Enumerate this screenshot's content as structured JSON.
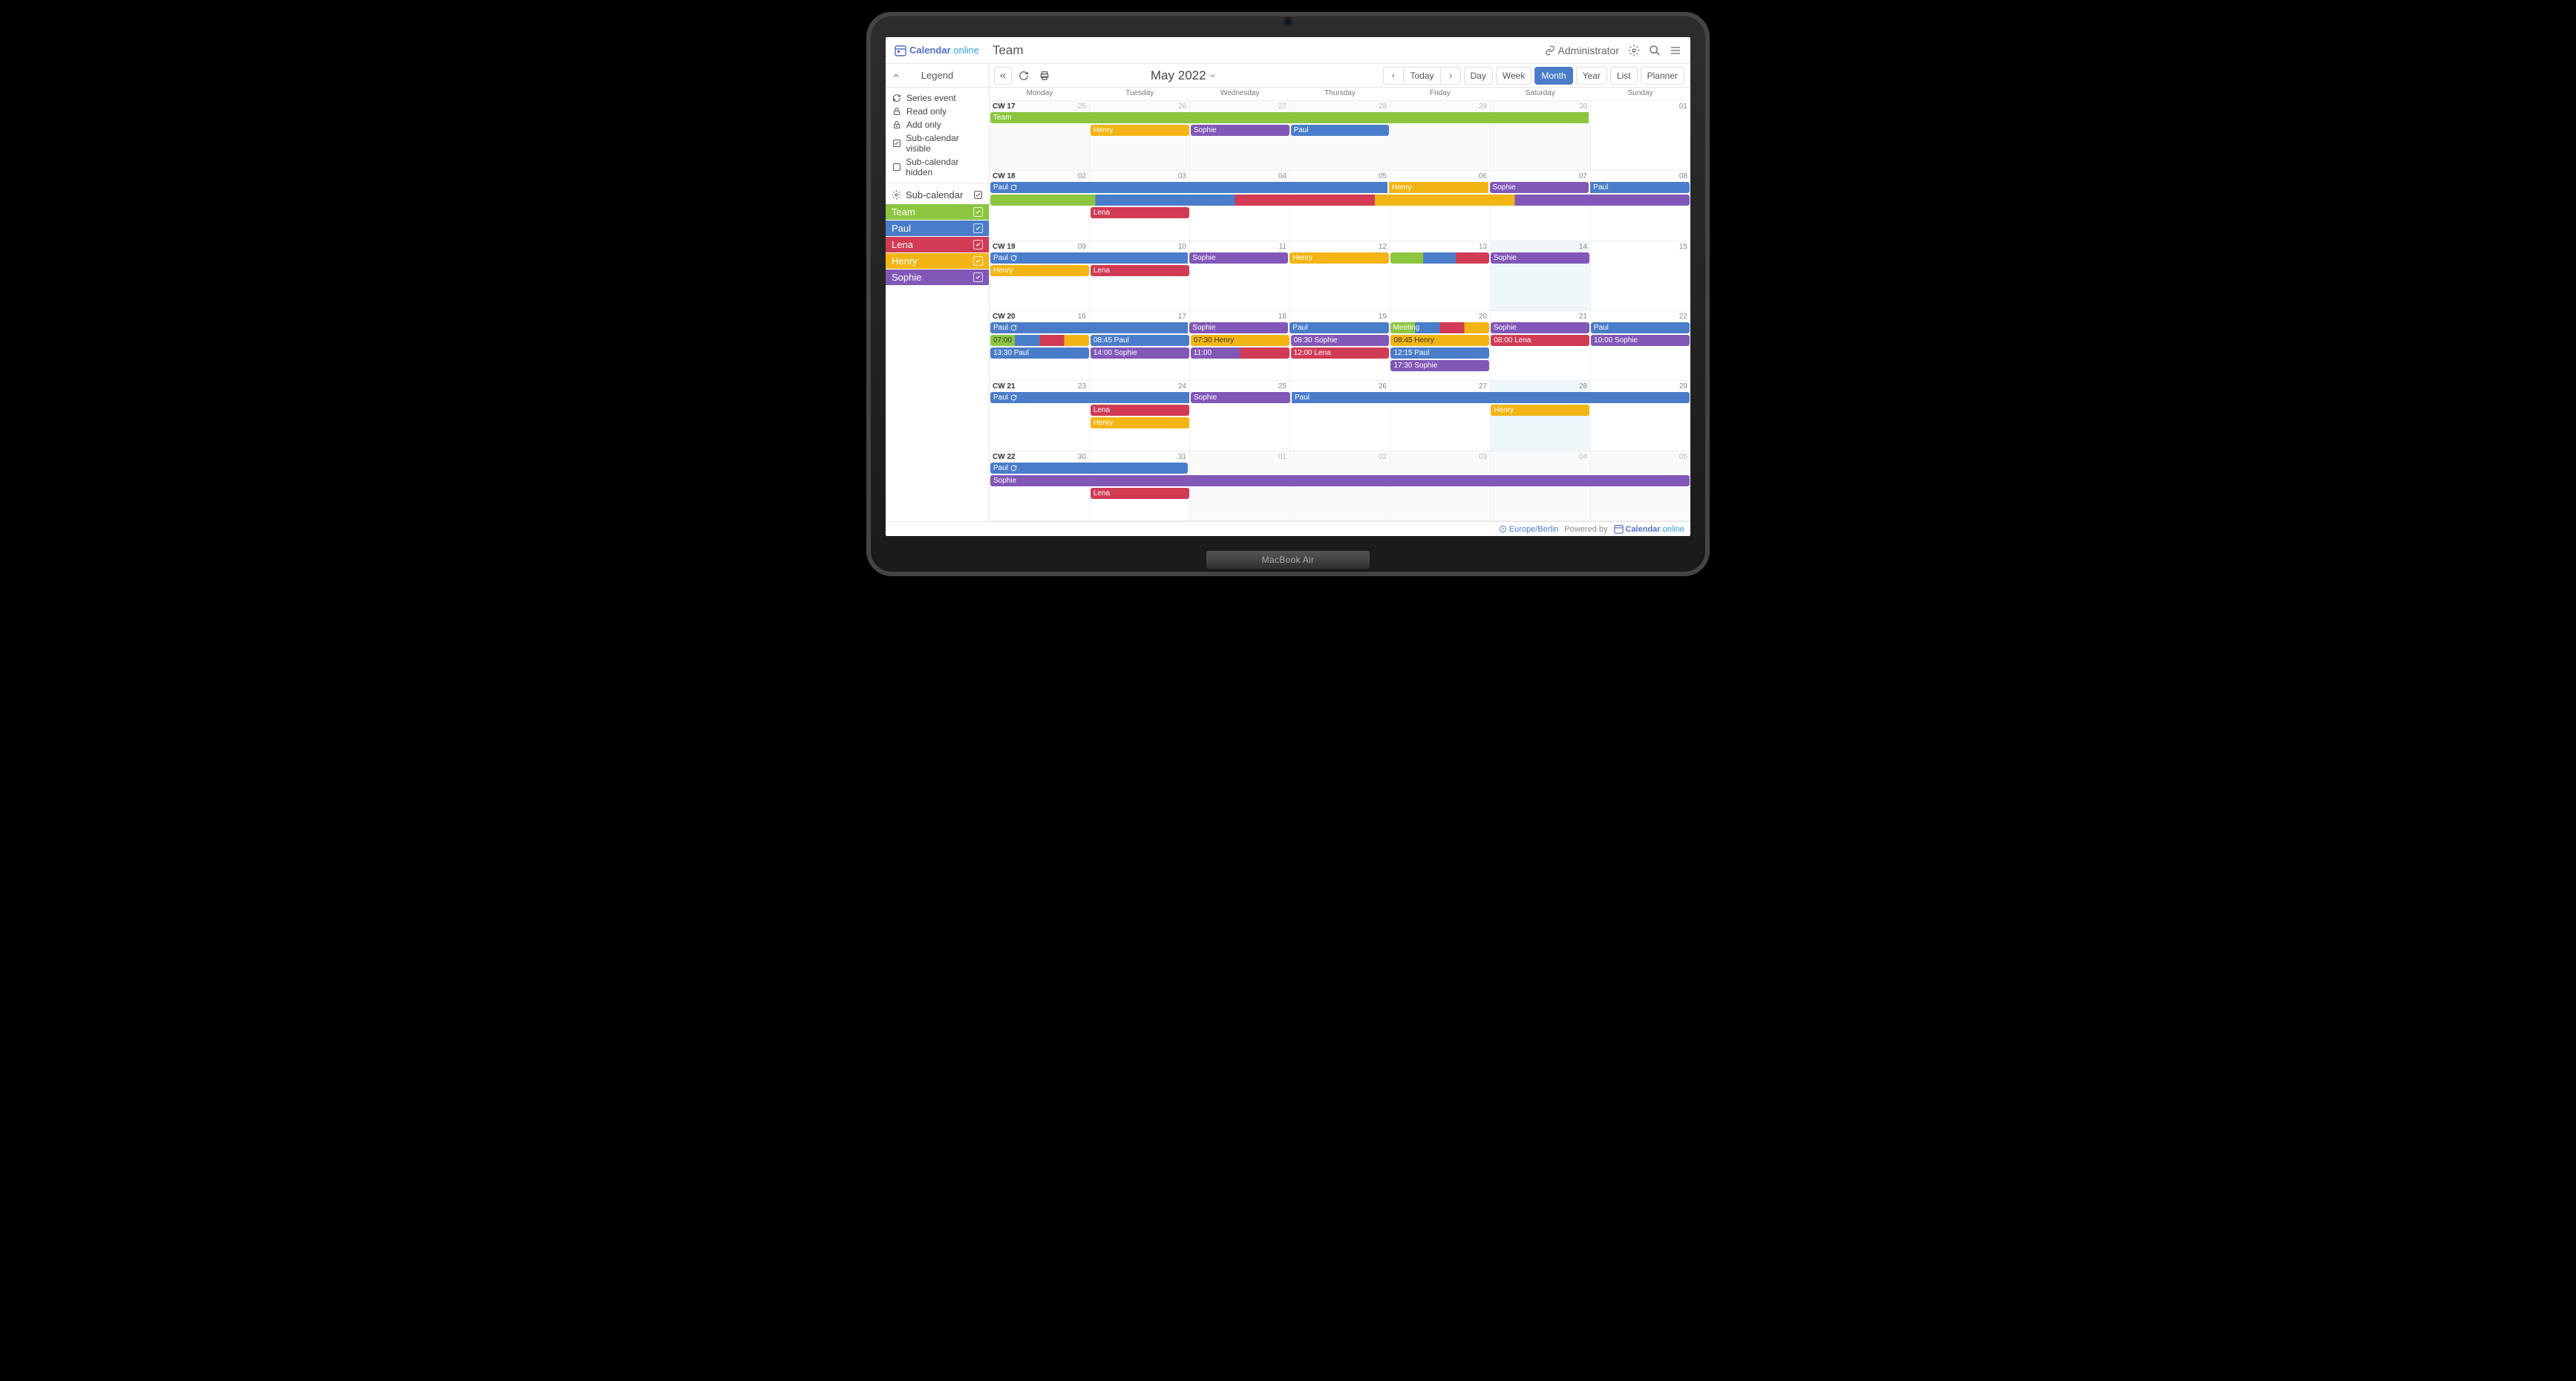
{
  "brand": {
    "text1": "Calendar",
    "text2": ".online"
  },
  "calendar_name": "Team",
  "admin_label": "Administrator",
  "legend_title": "Legend",
  "legend_items": [
    {
      "icon": "refresh",
      "label": "Series event"
    },
    {
      "icon": "lock",
      "label": "Read only"
    },
    {
      "icon": "plus-lock",
      "label": "Add only"
    },
    {
      "icon": "check",
      "label": "Sub-calendar visible"
    },
    {
      "icon": "box",
      "label": "Sub-calendar hidden"
    }
  ],
  "subcal_title": "Sub-calendar",
  "subcalendars": [
    {
      "name": "Team",
      "color": "#8cc63f"
    },
    {
      "name": "Paul",
      "color": "#4a7dc9"
    },
    {
      "name": "Lena",
      "color": "#d13b54"
    },
    {
      "name": "Henry",
      "color": "#f3b515"
    },
    {
      "name": "Sophie",
      "color": "#8157b7"
    }
  ],
  "date_label": "May 2022",
  "today_label": "Today",
  "views": [
    "Day",
    "Week",
    "Month",
    "Year",
    "List",
    "Planner"
  ],
  "active_view": "Month",
  "day_names": [
    "Monday",
    "Tuesday",
    "Wednesday",
    "Thursday",
    "Friday",
    "Saturday",
    "Sunday"
  ],
  "weeks": [
    {
      "cw": "CW 17",
      "days": [
        {
          "n": "25",
          "off": true
        },
        {
          "n": "26",
          "off": true
        },
        {
          "n": "27",
          "off": true
        },
        {
          "n": "28",
          "off": true
        },
        {
          "n": "29",
          "off": true
        },
        {
          "n": "30",
          "off": true
        },
        {
          "n": "01"
        }
      ]
    },
    {
      "cw": "CW 18",
      "days": [
        {
          "n": "02"
        },
        {
          "n": "03"
        },
        {
          "n": "04"
        },
        {
          "n": "05"
        },
        {
          "n": "06"
        },
        {
          "n": "07"
        },
        {
          "n": "08"
        }
      ]
    },
    {
      "cw": "CW 19",
      "days": [
        {
          "n": "09"
        },
        {
          "n": "10"
        },
        {
          "n": "11"
        },
        {
          "n": "12"
        },
        {
          "n": "13"
        },
        {
          "n": "14",
          "today": true
        },
        {
          "n": "15"
        }
      ]
    },
    {
      "cw": "CW 20",
      "days": [
        {
          "n": "16"
        },
        {
          "n": "17"
        },
        {
          "n": "18"
        },
        {
          "n": "19"
        },
        {
          "n": "20"
        },
        {
          "n": "21"
        },
        {
          "n": "22"
        }
      ]
    },
    {
      "cw": "CW 21",
      "days": [
        {
          "n": "23"
        },
        {
          "n": "24"
        },
        {
          "n": "25"
        },
        {
          "n": "26"
        },
        {
          "n": "27"
        },
        {
          "n": "28",
          "today": true
        },
        {
          "n": "29"
        }
      ]
    },
    {
      "cw": "CW 22",
      "days": [
        {
          "n": "30"
        },
        {
          "n": "31"
        },
        {
          "n": "01",
          "off": true
        },
        {
          "n": "02",
          "off": true
        },
        {
          "n": "03",
          "off": true
        },
        {
          "n": "04",
          "off": true
        },
        {
          "n": "05",
          "off": true
        }
      ]
    }
  ],
  "events": {
    "team": "Team",
    "paul": "Paul",
    "lena": "Lena",
    "henry": "Henry",
    "sophie": "Sophie",
    "meeting": "Meeting",
    "t0700": "07:00",
    "t0845p": "08:45 Paul",
    "t0730h": "07:30 Henry",
    "t0830s": "08:30 Sophie",
    "t0845h": "08:45 Henry",
    "t0800l": "08:00 Lena",
    "t1330p": "13:30 Paul",
    "t1400s": "14:00 Sophie",
    "t1100": "11:00",
    "t1200l": "12:00 Lena",
    "t1215p": "12:15 Paul",
    "t1730s": "17:30 Sophie",
    "t1000s": "10:00 Sophie"
  },
  "timezone": "Europe/Berlin",
  "powered_by": "Powered by",
  "laptop_label": "MacBook Air"
}
